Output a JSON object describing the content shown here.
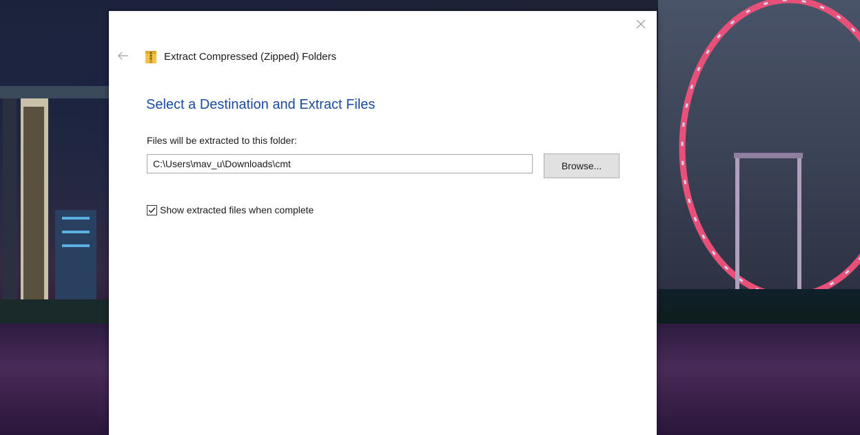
{
  "dialog": {
    "title": "Extract Compressed (Zipped) Folders",
    "heading": "Select a Destination and Extract Files",
    "path_label": "Files will be extracted to this folder:",
    "path_value": "C:\\Users\\mav_u\\Downloads\\cmt",
    "browse_label": "Browse...",
    "show_files_label": "Show extracted files when complete",
    "show_files_checked": true,
    "icons": {
      "back": "back-arrow-icon",
      "close": "close-icon",
      "zip": "zip-folder-icon",
      "check": "checkmark-icon"
    }
  },
  "colors": {
    "heading": "#1a4a9b",
    "dialog_bg": "#ffffff",
    "button_bg": "#e1e1e1"
  }
}
